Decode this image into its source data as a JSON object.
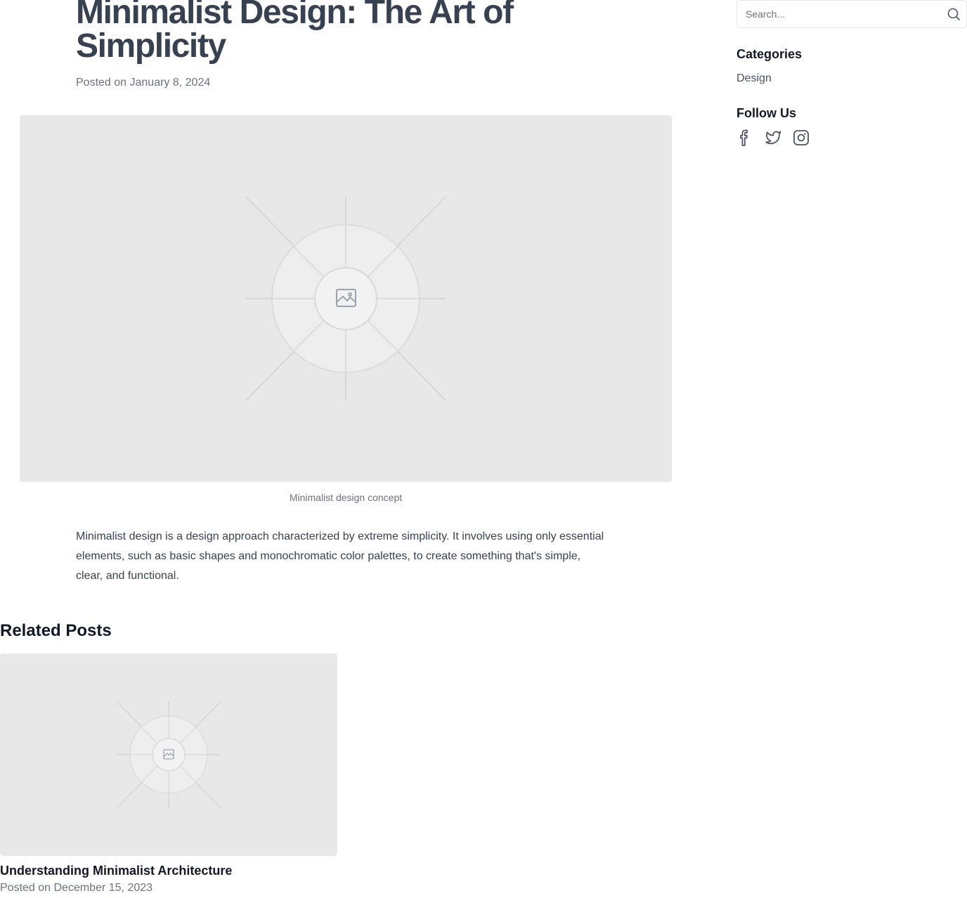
{
  "article": {
    "title": "Minimalist Design: The Art of Simplicity",
    "date": "Posted on January 8, 2024",
    "image_caption": "Minimalist design concept",
    "body": "Minimalist design is a design approach characterized by extreme simplicity. It involves using only essential elements, such as basic shapes and monochromatic color palettes, to create something that's simple, clear, and functional."
  },
  "related": {
    "heading": "Related Posts",
    "posts": [
      {
        "title": "Understanding Minimalist Architecture",
        "date": "Posted on December 15, 2023"
      }
    ]
  },
  "sidebar": {
    "search": {
      "placeholder": "Search...",
      "value": ""
    },
    "categories_heading": "Categories",
    "categories": [
      "Design"
    ],
    "follow_heading": "Follow Us",
    "social": [
      "facebook-icon",
      "twitter-icon",
      "instagram-icon"
    ]
  },
  "colors": {
    "title": "#374151",
    "muted": "#6b7280",
    "placeholder_bg": "#e8e8e8",
    "icon": "#4b5563"
  }
}
